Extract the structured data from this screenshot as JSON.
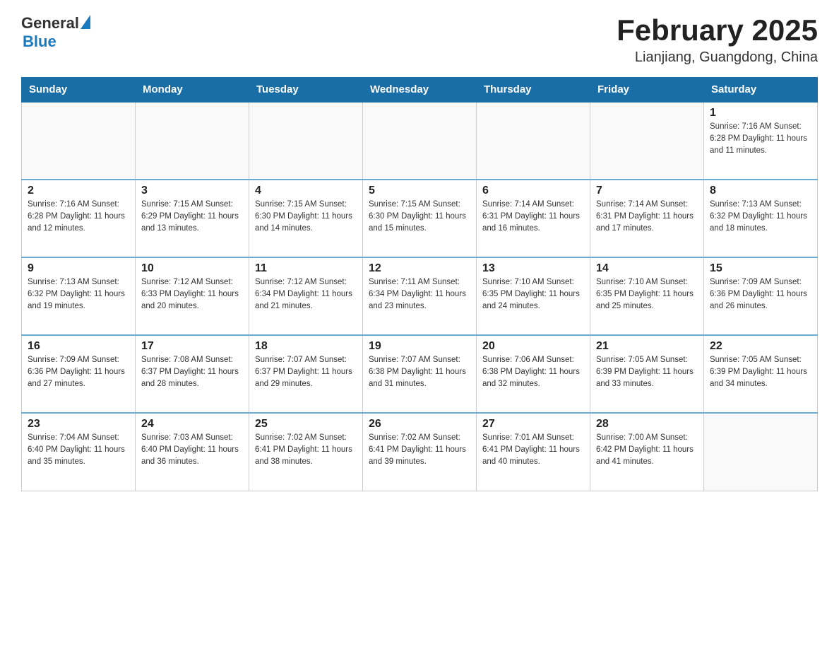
{
  "header": {
    "logo": {
      "general": "General",
      "blue": "Blue"
    },
    "title": "February 2025",
    "location": "Lianjiang, Guangdong, China"
  },
  "weekdays": [
    "Sunday",
    "Monday",
    "Tuesday",
    "Wednesday",
    "Thursday",
    "Friday",
    "Saturday"
  ],
  "weeks": [
    [
      {
        "day": "",
        "info": ""
      },
      {
        "day": "",
        "info": ""
      },
      {
        "day": "",
        "info": ""
      },
      {
        "day": "",
        "info": ""
      },
      {
        "day": "",
        "info": ""
      },
      {
        "day": "",
        "info": ""
      },
      {
        "day": "1",
        "info": "Sunrise: 7:16 AM\nSunset: 6:28 PM\nDaylight: 11 hours and 11 minutes."
      }
    ],
    [
      {
        "day": "2",
        "info": "Sunrise: 7:16 AM\nSunset: 6:28 PM\nDaylight: 11 hours and 12 minutes."
      },
      {
        "day": "3",
        "info": "Sunrise: 7:15 AM\nSunset: 6:29 PM\nDaylight: 11 hours and 13 minutes."
      },
      {
        "day": "4",
        "info": "Sunrise: 7:15 AM\nSunset: 6:30 PM\nDaylight: 11 hours and 14 minutes."
      },
      {
        "day": "5",
        "info": "Sunrise: 7:15 AM\nSunset: 6:30 PM\nDaylight: 11 hours and 15 minutes."
      },
      {
        "day": "6",
        "info": "Sunrise: 7:14 AM\nSunset: 6:31 PM\nDaylight: 11 hours and 16 minutes."
      },
      {
        "day": "7",
        "info": "Sunrise: 7:14 AM\nSunset: 6:31 PM\nDaylight: 11 hours and 17 minutes."
      },
      {
        "day": "8",
        "info": "Sunrise: 7:13 AM\nSunset: 6:32 PM\nDaylight: 11 hours and 18 minutes."
      }
    ],
    [
      {
        "day": "9",
        "info": "Sunrise: 7:13 AM\nSunset: 6:32 PM\nDaylight: 11 hours and 19 minutes."
      },
      {
        "day": "10",
        "info": "Sunrise: 7:12 AM\nSunset: 6:33 PM\nDaylight: 11 hours and 20 minutes."
      },
      {
        "day": "11",
        "info": "Sunrise: 7:12 AM\nSunset: 6:34 PM\nDaylight: 11 hours and 21 minutes."
      },
      {
        "day": "12",
        "info": "Sunrise: 7:11 AM\nSunset: 6:34 PM\nDaylight: 11 hours and 23 minutes."
      },
      {
        "day": "13",
        "info": "Sunrise: 7:10 AM\nSunset: 6:35 PM\nDaylight: 11 hours and 24 minutes."
      },
      {
        "day": "14",
        "info": "Sunrise: 7:10 AM\nSunset: 6:35 PM\nDaylight: 11 hours and 25 minutes."
      },
      {
        "day": "15",
        "info": "Sunrise: 7:09 AM\nSunset: 6:36 PM\nDaylight: 11 hours and 26 minutes."
      }
    ],
    [
      {
        "day": "16",
        "info": "Sunrise: 7:09 AM\nSunset: 6:36 PM\nDaylight: 11 hours and 27 minutes."
      },
      {
        "day": "17",
        "info": "Sunrise: 7:08 AM\nSunset: 6:37 PM\nDaylight: 11 hours and 28 minutes."
      },
      {
        "day": "18",
        "info": "Sunrise: 7:07 AM\nSunset: 6:37 PM\nDaylight: 11 hours and 29 minutes."
      },
      {
        "day": "19",
        "info": "Sunrise: 7:07 AM\nSunset: 6:38 PM\nDaylight: 11 hours and 31 minutes."
      },
      {
        "day": "20",
        "info": "Sunrise: 7:06 AM\nSunset: 6:38 PM\nDaylight: 11 hours and 32 minutes."
      },
      {
        "day": "21",
        "info": "Sunrise: 7:05 AM\nSunset: 6:39 PM\nDaylight: 11 hours and 33 minutes."
      },
      {
        "day": "22",
        "info": "Sunrise: 7:05 AM\nSunset: 6:39 PM\nDaylight: 11 hours and 34 minutes."
      }
    ],
    [
      {
        "day": "23",
        "info": "Sunrise: 7:04 AM\nSunset: 6:40 PM\nDaylight: 11 hours and 35 minutes."
      },
      {
        "day": "24",
        "info": "Sunrise: 7:03 AM\nSunset: 6:40 PM\nDaylight: 11 hours and 36 minutes."
      },
      {
        "day": "25",
        "info": "Sunrise: 7:02 AM\nSunset: 6:41 PM\nDaylight: 11 hours and 38 minutes."
      },
      {
        "day": "26",
        "info": "Sunrise: 7:02 AM\nSunset: 6:41 PM\nDaylight: 11 hours and 39 minutes."
      },
      {
        "day": "27",
        "info": "Sunrise: 7:01 AM\nSunset: 6:41 PM\nDaylight: 11 hours and 40 minutes."
      },
      {
        "day": "28",
        "info": "Sunrise: 7:00 AM\nSunset: 6:42 PM\nDaylight: 11 hours and 41 minutes."
      },
      {
        "day": "",
        "info": ""
      }
    ]
  ]
}
